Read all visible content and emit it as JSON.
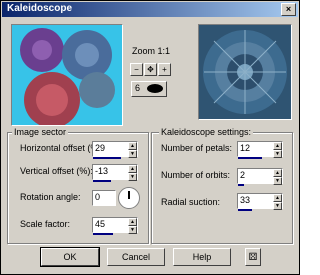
{
  "window": {
    "title": "Kaleidoscope",
    "close_label": "×"
  },
  "preview": {
    "zoom_label": "Zoom 1:1",
    "zoom_in": "+",
    "zoom_out": "−",
    "pan": "✥",
    "six": "6"
  },
  "image_sector": {
    "label": "Image sector",
    "horizontal_offset": {
      "label": "Horizontal offset (%):",
      "value": "29"
    },
    "vertical_offset": {
      "label": "Vertical offset (%):",
      "value": "-13"
    },
    "rotation_angle": {
      "label": "Rotation angle:",
      "value": "0"
    },
    "scale_factor": {
      "label": "Scale factor:",
      "value": "45"
    }
  },
  "kaleidoscope_settings": {
    "label": "Kaleidoscope settings:",
    "petals": {
      "label": "Number of petals:",
      "value": "12"
    },
    "orbits": {
      "label": "Number of orbits:",
      "value": "2"
    },
    "radial_suction": {
      "label": "Radial suction:",
      "value": "33"
    }
  },
  "buttons": {
    "ok": "OK",
    "cancel": "Cancel",
    "help": "Help"
  }
}
